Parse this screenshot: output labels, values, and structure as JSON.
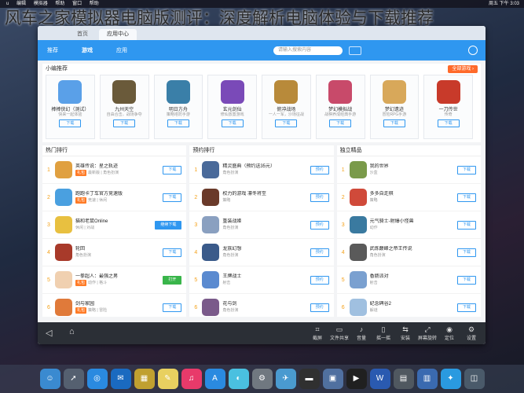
{
  "overlay_title": "风车之家模拟器电脑版测评：深度解析电脑体验与下载推荐",
  "menubar": {
    "items": [
      "u",
      "编辑",
      "模拟器",
      "帮助",
      "窗口",
      "帮助"
    ],
    "clock": "周五 下午 3:03"
  },
  "tabs": [
    {
      "label": "首页",
      "active": false
    },
    {
      "label": "应用中心",
      "active": true
    }
  ],
  "appbar": {
    "nav": [
      "推荐",
      "游戏",
      "应用"
    ],
    "search_placeholder": "请输入搜索内容"
  },
  "recommend": {
    "title": "小编推荐",
    "more_label": "全部游戏 ›",
    "cards": [
      {
        "name": "棒棒侠幻（测试）",
        "sub": "快来一起体验",
        "dl": "下载",
        "color": "#5aa0e8"
      },
      {
        "name": "九州天空",
        "sub": "自由合击，战场争夺",
        "dl": "下载",
        "color": "#6a5a3a"
      },
      {
        "name": "明日方舟",
        "sub": "策略塔防手游",
        "dl": "下载",
        "color": "#3a7fa8"
      },
      {
        "name": "玄元剑仙",
        "sub": "修仙放置游戏",
        "dl": "下载",
        "color": "#7a4ab8"
      },
      {
        "name": "俯冲战场",
        "sub": "一人一军，沙场征战",
        "dl": "下载",
        "color": "#b88a3a"
      },
      {
        "name": "梦幻模拟战",
        "sub": "战棋养成经典手游",
        "dl": "下载",
        "color": "#c84a6a"
      },
      {
        "name": "梦幻遗迹",
        "sub": "冒险RPG手游",
        "dl": "下载",
        "color": "#d8a85a"
      },
      {
        "name": "一刀传世",
        "sub": "传奇",
        "dl": "下载",
        "color": "#c83a2a"
      }
    ]
  },
  "hot_rank": {
    "title": "热门排行",
    "rows": [
      {
        "rank": "1",
        "title": "英雄传说：星之轨迹",
        "tag": "礼包",
        "sub": "最新版 | 角色扮演",
        "btn": "下载",
        "style": "",
        "color": "#e0a040"
      },
      {
        "name_unused": "",
        "rank": "2",
        "title": "跑跑卡丁车官方竞速版",
        "tag": "礼包",
        "sub": "竞速 | 休闲",
        "btn": "下载",
        "style": "",
        "color": "#4aa0e0"
      },
      {
        "rank": "3",
        "title": "猫和老鼠Online",
        "tag": "",
        "sub": "休闲 | 对战",
        "btn": "继续下载",
        "style": "blue",
        "color": "#e8c040"
      },
      {
        "rank": "4",
        "title": "轮回",
        "tag": "",
        "sub": "角色扮演",
        "btn": "下载",
        "style": "",
        "color": "#a83a2a"
      },
      {
        "rank": "5",
        "title": "一拳超人：最强之男",
        "tag": "礼包",
        "sub": "动作 | 格斗",
        "btn": "打开",
        "style": "green",
        "color": "#f0d0b0"
      },
      {
        "rank": "6",
        "title": "剑与家园",
        "tag": "礼包",
        "sub": "策略 | 冒险",
        "btn": "下载",
        "style": "",
        "color": "#e07a3a"
      }
    ]
  },
  "preorder_rank": {
    "title": "预约排行",
    "rows": [
      {
        "rank": "1",
        "title": "精灵盛典（预约送35元）",
        "tag": "",
        "sub": "角色扮演",
        "btn": "预约",
        "style": "",
        "color": "#4a6a9a"
      },
      {
        "rank": "2",
        "title": "权力的游戏 凛冬将至",
        "tag": "",
        "sub": "策略",
        "btn": "预约",
        "style": "",
        "color": "#6a3a2a"
      },
      {
        "rank": "3",
        "title": "重装战姬",
        "tag": "",
        "sub": "角色扮演",
        "btn": "预约",
        "style": "",
        "color": "#8aa0c0"
      },
      {
        "rank": "4",
        "title": "龙族幻想",
        "tag": "",
        "sub": "角色扮演",
        "btn": "预约",
        "style": "",
        "color": "#3a5a8a"
      },
      {
        "rank": "5",
        "title": "王牌战士",
        "tag": "",
        "sub": "射击",
        "btn": "预约",
        "style": "",
        "color": "#5a8ad0"
      },
      {
        "rank": "6",
        "title": "花与剑",
        "tag": "",
        "sub": "角色扮演",
        "btn": "预约",
        "style": "",
        "color": "#7a5a8a"
      }
    ]
  },
  "boutique": {
    "title": "独立精品",
    "rows": [
      {
        "rank": "1",
        "title": "我的世界",
        "tag": "",
        "sub": "沙盒",
        "btn": "下载",
        "style": "",
        "color": "#7a9a4a"
      },
      {
        "rank": "2",
        "title": "多多自走棋",
        "tag": "",
        "sub": "策略",
        "btn": "下载",
        "style": "",
        "color": "#d04a3a"
      },
      {
        "rank": "3",
        "title": "元气骑士-射爆小怪兽",
        "tag": "",
        "sub": "动作",
        "btn": "下载",
        "style": "",
        "color": "#3a7aa0"
      },
      {
        "rank": "4",
        "title": "武炼巅峰之帝王传说",
        "tag": "",
        "sub": "角色扮演",
        "btn": "下载",
        "style": "",
        "color": "#5a5a5a"
      },
      {
        "rank": "5",
        "title": "香肠派对",
        "tag": "",
        "sub": "射击",
        "btn": "下载",
        "style": "",
        "color": "#7aa0d0"
      },
      {
        "rank": "6",
        "title": "纪念碑谷2",
        "tag": "",
        "sub": "解谜",
        "btn": "下载",
        "style": "",
        "color": "#a0c0e0"
      }
    ]
  },
  "bottom_tools": [
    {
      "icon": "⌗",
      "label": "截屏"
    },
    {
      "icon": "▭",
      "label": "文件共享"
    },
    {
      "icon": "♪",
      "label": "音量"
    },
    {
      "icon": "▯",
      "label": "摇一摇"
    },
    {
      "icon": "⇆",
      "label": "安装"
    },
    {
      "icon": "⤢",
      "label": "屏幕旋转"
    },
    {
      "icon": "◉",
      "label": "定位"
    },
    {
      "icon": "⚙",
      "label": "设置"
    }
  ],
  "dock": [
    {
      "icon": "☺",
      "color": "#3a8ad0"
    },
    {
      "icon": "➚",
      "color": "#556070"
    },
    {
      "icon": "◎",
      "color": "#2a8ae0"
    },
    {
      "icon": "✉",
      "color": "#1a6ac0"
    },
    {
      "icon": "▦",
      "color": "#c0a030"
    },
    {
      "icon": "✎",
      "color": "#e8d060"
    },
    {
      "icon": "♫",
      "color": "#e83a6a"
    },
    {
      "icon": "A",
      "color": "#2a8ae0"
    },
    {
      "icon": "◐",
      "color": "#4ac0e0"
    },
    {
      "icon": "⚙",
      "color": "#707880"
    },
    {
      "icon": "✈",
      "color": "#4a9ad0"
    },
    {
      "icon": "▬",
      "color": "#303030"
    },
    {
      "icon": "▣",
      "color": "#5070a0"
    },
    {
      "icon": "▶",
      "color": "#202020"
    },
    {
      "icon": "W",
      "color": "#2a5ab0"
    },
    {
      "icon": "▤",
      "color": "#505860"
    },
    {
      "icon": "▥",
      "color": "#3a6ab0"
    },
    {
      "icon": "✦",
      "color": "#2a9ae0"
    },
    {
      "icon": "◫",
      "color": "#4a5a6a"
    }
  ]
}
